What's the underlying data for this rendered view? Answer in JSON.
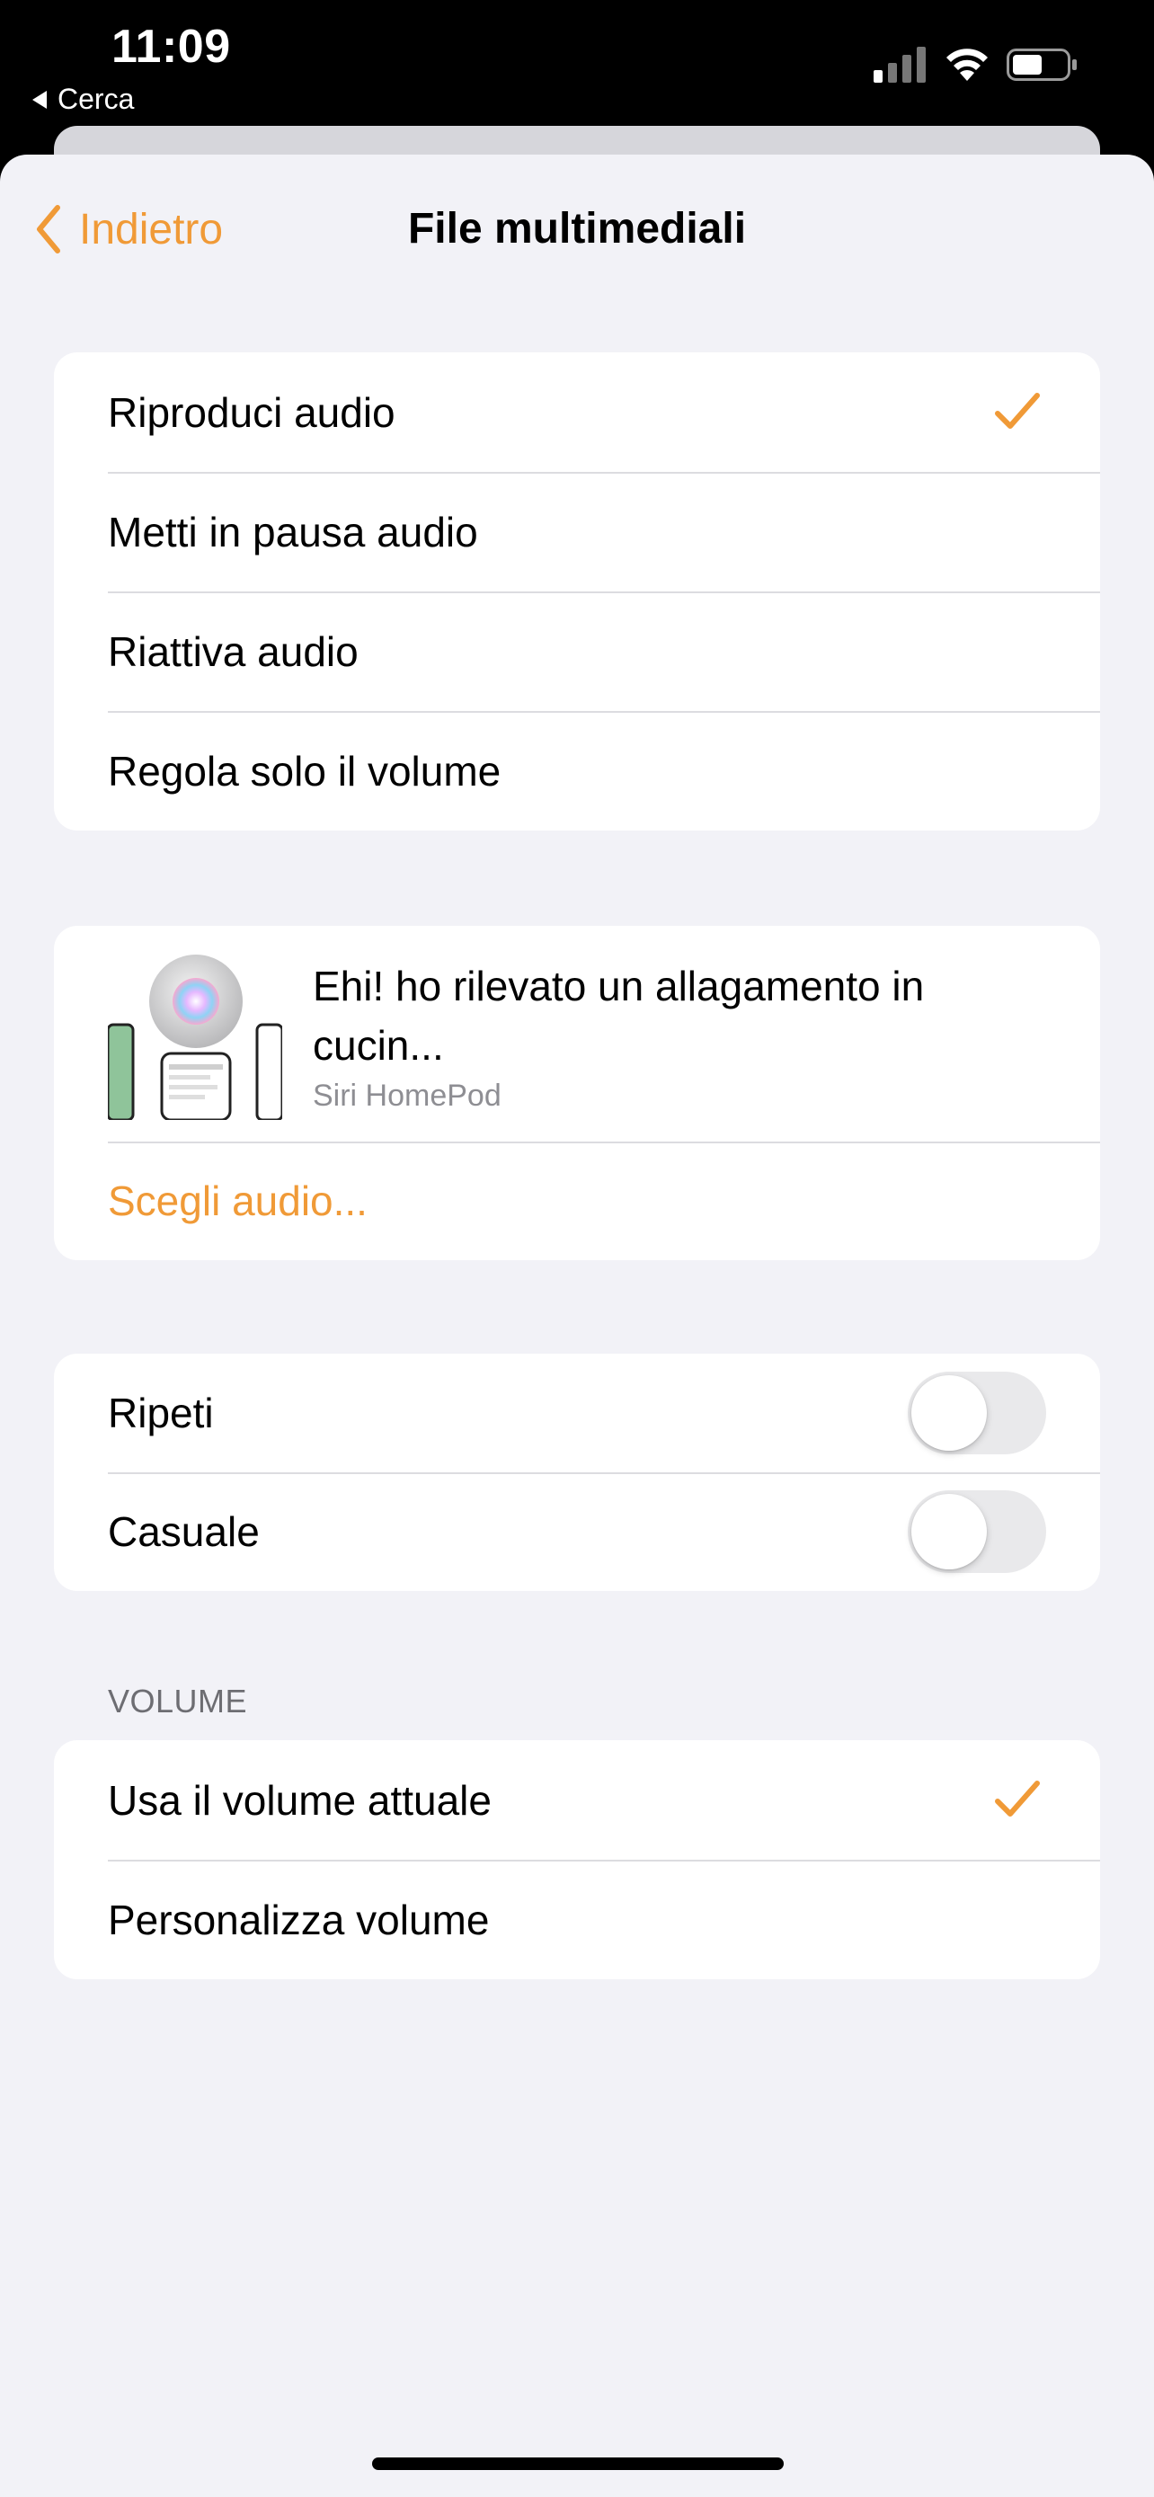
{
  "status_bar": {
    "time": "11:09",
    "back_app": "Cerca",
    "icons": [
      "signal-icon",
      "wifi-icon",
      "battery-icon"
    ]
  },
  "nav": {
    "back_label": "Indietro",
    "title": "File multimediali",
    "accent_color": "#f09a37"
  },
  "playback_options": [
    {
      "label": "Riproduci audio",
      "selected": true
    },
    {
      "label": "Metti in pausa audio",
      "selected": false
    },
    {
      "label": "Riattiva audio",
      "selected": false
    },
    {
      "label": "Regola solo il volume",
      "selected": false
    }
  ],
  "audio": {
    "title": "Ehi! ho rilevato un allagamento in cucin...",
    "subtitle": "Siri HomePod",
    "choose_label": "Scegli audio..."
  },
  "toggles": [
    {
      "label": "Ripeti",
      "on": false
    },
    {
      "label": "Casuale",
      "on": false
    }
  ],
  "volume": {
    "header": "VOLUME",
    "options": [
      {
        "label": "Usa il volume attuale",
        "selected": true
      },
      {
        "label": "Personalizza volume",
        "selected": false
      }
    ]
  }
}
